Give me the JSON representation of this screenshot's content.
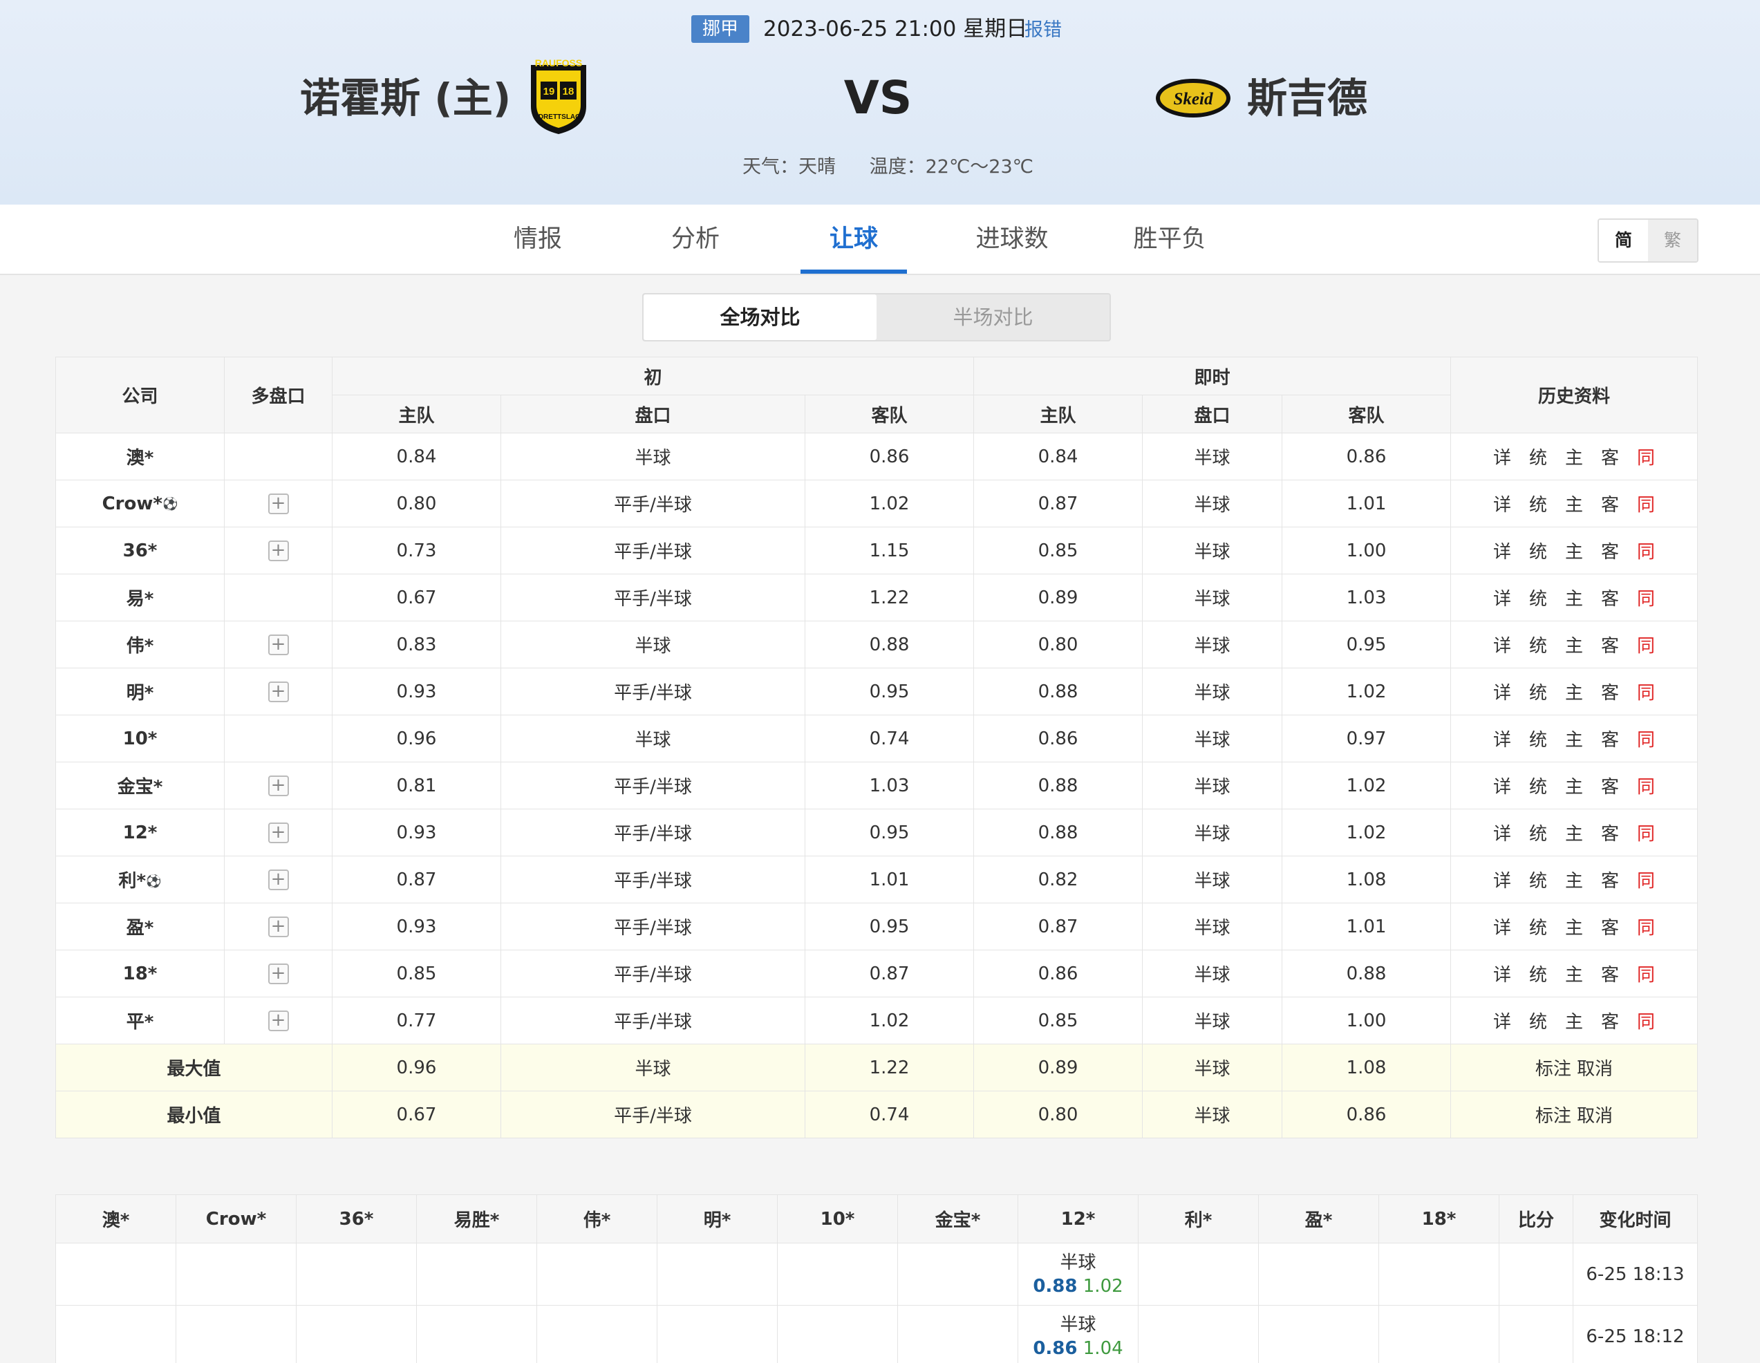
{
  "header": {
    "league": "挪甲",
    "datetime": "2023-06-25 21:00 星期日",
    "report": "报错",
    "home_team": "诺霍斯 (主)",
    "away_team": "斯吉德",
    "vs": "VS",
    "weather_label": "天气：天晴",
    "temp_label": "温度：22℃～23℃",
    "home_logo_text": {
      "top": "RAUFOSS",
      "n1": "19",
      "n2": "18",
      "bottom": "IDRETTSLAG"
    },
    "away_logo_text": "Skeid"
  },
  "nav": {
    "tabs": [
      "情报",
      "分析",
      "让球",
      "进球数",
      "胜平负"
    ],
    "active": "让球",
    "lang_simplified": "简",
    "lang_traditional": "繁"
  },
  "segment": {
    "full": "全场对比",
    "half": "半场对比"
  },
  "odds_table": {
    "headers": {
      "company": "公司",
      "multi": "多盘口",
      "initial": "初",
      "live": "即时",
      "history": "历史资料",
      "home": "主队",
      "line": "盘口",
      "away": "客队"
    },
    "history_links": [
      "详",
      "统",
      "主",
      "客",
      "同"
    ],
    "rows": [
      {
        "company": "澳*",
        "ball": false,
        "plus": false,
        "i_home": "0.84",
        "i_line": "半球",
        "i_away": "0.86",
        "l_home": "0.84",
        "l_line": "半球",
        "l_away": "0.86"
      },
      {
        "company": "Crow*",
        "ball": true,
        "plus": true,
        "i_home": "0.80",
        "i_line": "平手/半球",
        "i_away": "1.02",
        "l_home": "0.87",
        "l_line": "半球",
        "l_away": "1.01"
      },
      {
        "company": "36*",
        "ball": false,
        "plus": true,
        "i_home": "0.73",
        "i_line": "平手/半球",
        "i_away": "1.15",
        "l_home": "0.85",
        "l_line": "半球",
        "l_away": "1.00"
      },
      {
        "company": "易*",
        "ball": false,
        "plus": false,
        "i_home": "0.67",
        "i_line": "平手/半球",
        "i_away": "1.22",
        "l_home": "0.89",
        "l_line": "半球",
        "l_away": "1.03"
      },
      {
        "company": "伟*",
        "ball": false,
        "plus": true,
        "i_home": "0.83",
        "i_line": "半球",
        "i_away": "0.88",
        "l_home": "0.80",
        "l_line": "半球",
        "l_away": "0.95"
      },
      {
        "company": "明*",
        "ball": false,
        "plus": true,
        "i_home": "0.93",
        "i_line": "平手/半球",
        "i_away": "0.95",
        "l_home": "0.88",
        "l_line": "半球",
        "l_away": "1.02"
      },
      {
        "company": "10*",
        "ball": false,
        "plus": false,
        "i_home": "0.96",
        "i_line": "半球",
        "i_away": "0.74",
        "l_home": "0.86",
        "l_line": "半球",
        "l_away": "0.97"
      },
      {
        "company": "金宝*",
        "ball": false,
        "plus": true,
        "i_home": "0.81",
        "i_line": "平手/半球",
        "i_away": "1.03",
        "l_home": "0.88",
        "l_line": "半球",
        "l_away": "1.02"
      },
      {
        "company": "12*",
        "ball": false,
        "plus": true,
        "i_home": "0.93",
        "i_line": "平手/半球",
        "i_away": "0.95",
        "l_home": "0.88",
        "l_line": "半球",
        "l_away": "1.02"
      },
      {
        "company": "利*",
        "ball": true,
        "plus": true,
        "i_home": "0.87",
        "i_line": "平手/半球",
        "i_away": "1.01",
        "l_home": "0.82",
        "l_line": "半球",
        "l_away": "1.08"
      },
      {
        "company": "盈*",
        "ball": false,
        "plus": true,
        "i_home": "0.93",
        "i_line": "平手/半球",
        "i_away": "0.95",
        "l_home": "0.87",
        "l_line": "半球",
        "l_away": "1.01"
      },
      {
        "company": "18*",
        "ball": false,
        "plus": true,
        "i_home": "0.85",
        "i_line": "平手/半球",
        "i_away": "0.87",
        "l_home": "0.86",
        "l_line": "半球",
        "l_away": "0.88"
      },
      {
        "company": "平*",
        "ball": false,
        "plus": true,
        "i_home": "0.77",
        "i_line": "平手/半球",
        "i_away": "1.02",
        "l_home": "0.85",
        "l_line": "半球",
        "l_away": "1.00"
      }
    ],
    "summary": [
      {
        "label": "最大值",
        "i_home": "0.96",
        "i_line": "半球",
        "i_away": "1.22",
        "l_home": "0.89",
        "l_line": "半球",
        "l_away": "1.08",
        "mark": "标注",
        "cancel": "取消"
      },
      {
        "label": "最小值",
        "i_home": "0.67",
        "i_line": "平手/半球",
        "i_away": "0.74",
        "l_home": "0.80",
        "l_line": "半球",
        "l_away": "0.86",
        "mark": "标注",
        "cancel": "取消"
      }
    ]
  },
  "change_table": {
    "headers": [
      "澳*",
      "Crow*",
      "36*",
      "易胜*",
      "伟*",
      "明*",
      "10*",
      "金宝*",
      "12*",
      "利*",
      "盈*",
      "18*",
      "比分",
      "变化时间"
    ],
    "rows": [
      {
        "col": 8,
        "line": "半球",
        "home": "0.88",
        "away": "1.02",
        "score": "",
        "time": "6-25 18:13"
      },
      {
        "col": 8,
        "line": "半球",
        "home": "0.86",
        "away": "1.04",
        "score": "",
        "time": "6-25 18:12"
      }
    ]
  },
  "colors": {
    "accent": "#1f6fd0",
    "league_badge": "#4a83c9",
    "history_red": "#e02525",
    "summary_bg": "#fdfdea",
    "home_odds": "#1b5f9e",
    "away_odds": "#3f9a3f"
  }
}
